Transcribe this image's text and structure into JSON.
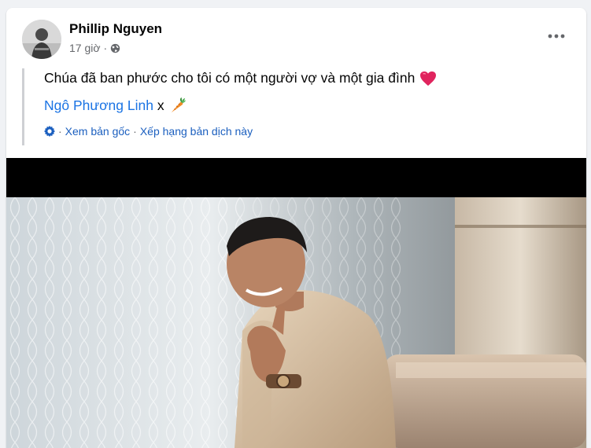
{
  "post": {
    "author": "Phillip Nguyen",
    "time": "17 giờ",
    "meta_separator": "·",
    "text": "Chúa đã ban phước cho tôi có một người vợ và một gia đình",
    "mention": "Ngô Phương Linh",
    "mention_suffix": " x",
    "translation": {
      "prefix": "·",
      "view_original": "Xem bản gốc",
      "separator": "·",
      "rate_translation": "Xếp hạng bản dịch này"
    }
  },
  "icons": {
    "privacy": "globe-icon",
    "menu": "more-horizontal-icon",
    "emoji_1": "red-heart-emoji",
    "emoji_2": "carrot-emoji",
    "translate": "gear-icon"
  },
  "colors": {
    "link": "#1b74e4",
    "translate_link": "#1b5fbf",
    "secondary_text": "#65676b",
    "heart": "#e0245e",
    "carrot": "#f28c28"
  }
}
